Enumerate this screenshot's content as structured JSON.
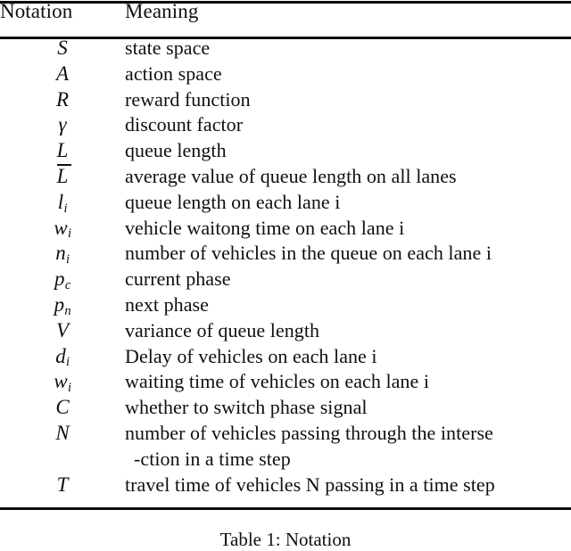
{
  "table": {
    "columns": [
      "Notation",
      "Meaning"
    ],
    "rows": [
      {
        "symbol": "S",
        "sub": "",
        "overbar": false,
        "meaning": "state space"
      },
      {
        "symbol": "A",
        "sub": "",
        "overbar": false,
        "meaning": "action space"
      },
      {
        "symbol": "R",
        "sub": "",
        "overbar": false,
        "meaning": "reward function"
      },
      {
        "symbol": "γ",
        "sub": "",
        "overbar": false,
        "meaning": "discount factor"
      },
      {
        "symbol": "L",
        "sub": "",
        "overbar": false,
        "meaning": "queue length"
      },
      {
        "symbol": "L",
        "sub": "",
        "overbar": true,
        "meaning": "average value of queue length on all lanes"
      },
      {
        "symbol": "l",
        "sub": "i",
        "overbar": false,
        "meaning": "queue length on each lane i"
      },
      {
        "symbol": "w",
        "sub": "i",
        "overbar": false,
        "meaning": "vehicle waitong time on each lane i"
      },
      {
        "symbol": "n",
        "sub": "i",
        "overbar": false,
        "meaning": "number of vehicles in the queue on each lane i"
      },
      {
        "symbol": "p",
        "sub": "c",
        "overbar": false,
        "meaning": "current phase"
      },
      {
        "symbol": "p",
        "sub": "n",
        "overbar": false,
        "meaning": "next phase"
      },
      {
        "symbol": "V",
        "sub": "",
        "overbar": false,
        "meaning": "variance of queue length"
      },
      {
        "symbol": "d",
        "sub": "i",
        "overbar": false,
        "meaning": "Delay of vehicles on each lane i"
      },
      {
        "symbol": "w",
        "sub": "i",
        "overbar": false,
        "meaning": "waiting time of vehicles on each lane i"
      },
      {
        "symbol": "C",
        "sub": "",
        "overbar": false,
        "meaning": "whether to switch phase signal"
      },
      {
        "symbol": "N",
        "sub": "",
        "overbar": false,
        "meaning": "number of vehicles passing through the interse",
        "meaning_line2": "-ction in a time step"
      },
      {
        "symbol": "T",
        "sub": "",
        "overbar": false,
        "meaning": "travel time of vehicles N passing in a time step"
      }
    ]
  },
  "caption": "Table 1: Notation"
}
